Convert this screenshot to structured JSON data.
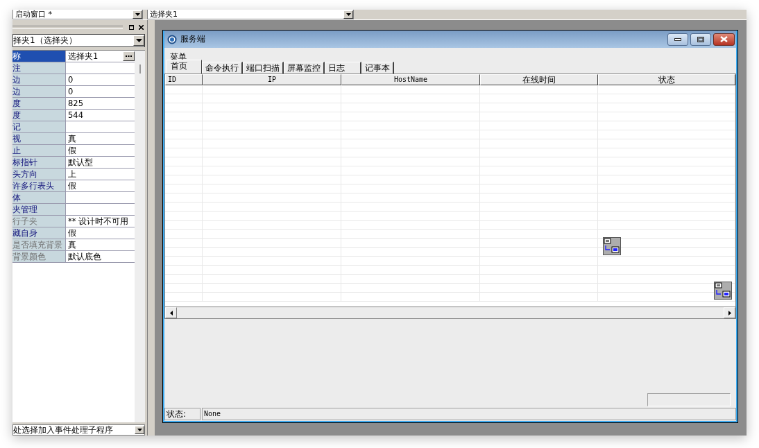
{
  "toolbar": {
    "window_combo": "启动窗口 *",
    "control_combo": "选择夹1"
  },
  "properties": {
    "object_combo": "择夹1（选择夹）",
    "rows": [
      {
        "name": "称",
        "value": "选择夹1",
        "selected": true,
        "disabled": false,
        "has_button": true
      },
      {
        "name": "注",
        "value": "",
        "selected": false,
        "disabled": false
      },
      {
        "name": "边",
        "value": "0",
        "selected": false,
        "disabled": false
      },
      {
        "name": "边",
        "value": "0",
        "selected": false,
        "disabled": false
      },
      {
        "name": "度",
        "value": "825",
        "selected": false,
        "disabled": false
      },
      {
        "name": "度",
        "value": "544",
        "selected": false,
        "disabled": false
      },
      {
        "name": "记",
        "value": "",
        "selected": false,
        "disabled": false
      },
      {
        "name": "视",
        "value": "真",
        "selected": false,
        "disabled": false
      },
      {
        "name": "止",
        "value": "假",
        "selected": false,
        "disabled": false
      },
      {
        "name": "标指针",
        "value": "默认型",
        "selected": false,
        "disabled": false
      },
      {
        "name": "头方向",
        "value": "上",
        "selected": false,
        "disabled": false
      },
      {
        "name": "许多行表头",
        "value": "假",
        "selected": false,
        "disabled": false
      },
      {
        "name": "体",
        "value": "",
        "selected": false,
        "disabled": false
      },
      {
        "name": "夹管理",
        "value": "",
        "selected": false,
        "disabled": false
      },
      {
        "name": "行子夹",
        "value": "** 设计时不可用",
        "selected": false,
        "disabled": true
      },
      {
        "name": "藏自身",
        "value": "假",
        "selected": false,
        "disabled": false
      },
      {
        "name": "是否填充背景",
        "value": "真",
        "selected": false,
        "disabled": true
      },
      {
        "name": "背景颜色",
        "value": "默认底色",
        "selected": false,
        "disabled": true
      }
    ],
    "event_combo": "处选择加入事件处理子程序"
  },
  "window": {
    "title": "服务端",
    "menu": "菜单",
    "tabs": [
      {
        "label": "首页",
        "selected": true
      },
      {
        "label": "命令执行",
        "selected": false
      },
      {
        "label": "端口扫描",
        "selected": false
      },
      {
        "label": "屏幕监控",
        "selected": false
      },
      {
        "label": "日志",
        "selected": false
      },
      {
        "label": "记事本",
        "selected": false
      }
    ],
    "table": {
      "columns": [
        "ID",
        "IP",
        "HostName",
        "在线时间",
        "状态"
      ]
    },
    "status_bar": {
      "label": "状态:",
      "value": "None"
    }
  }
}
